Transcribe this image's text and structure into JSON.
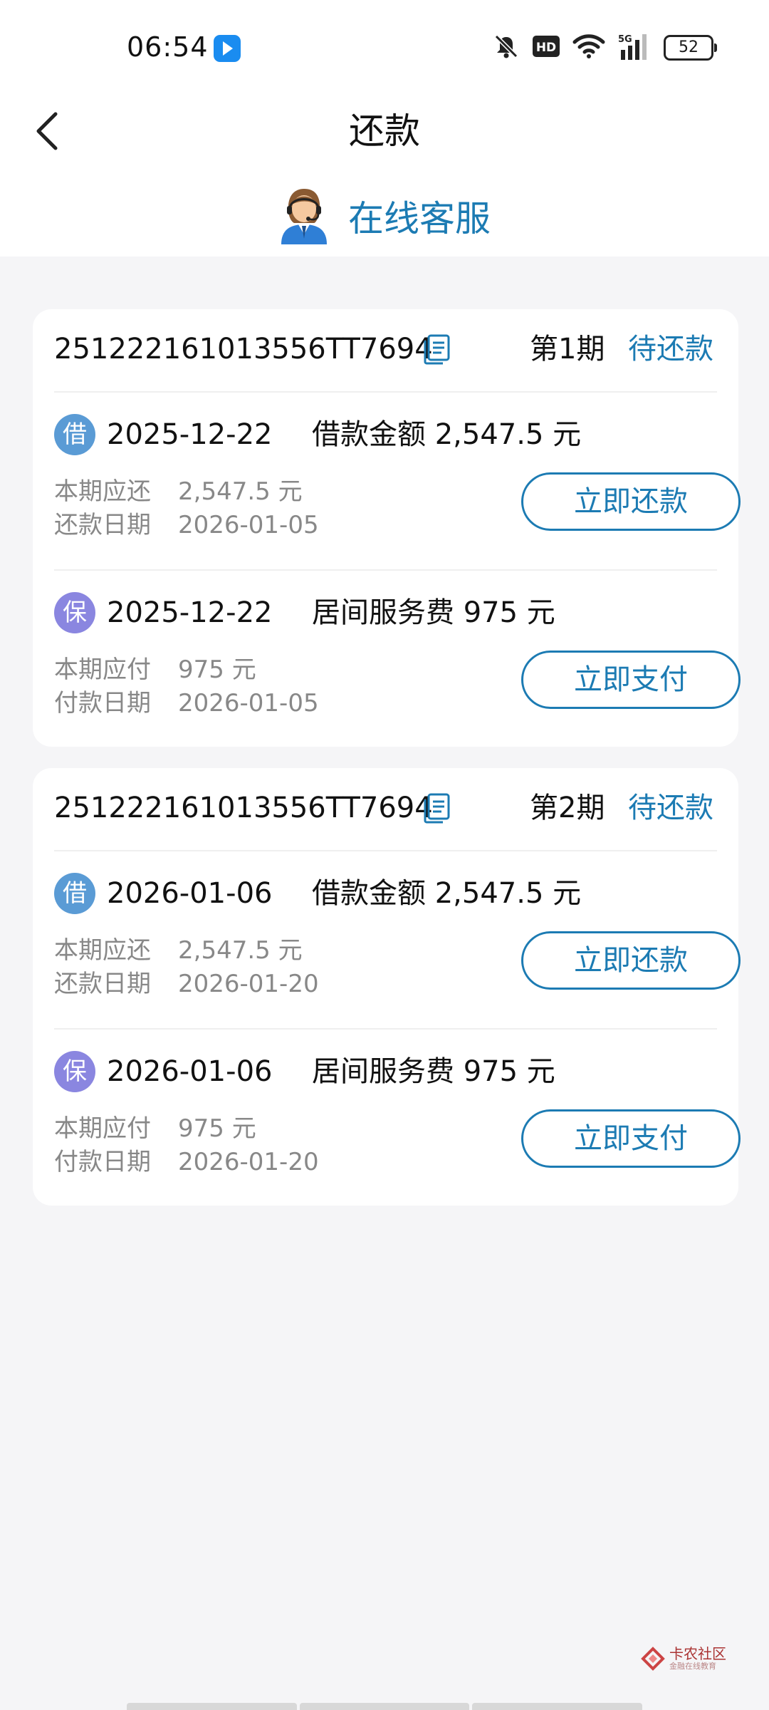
{
  "status_bar": {
    "time": "06:54",
    "battery": "52"
  },
  "header": {
    "title": "还款",
    "customer_service": "在线客服"
  },
  "cards": [
    {
      "order_no": "251222161013556TT7694",
      "period": "第1期",
      "status": "待还款",
      "loan": {
        "badge": "借",
        "date": "2025-12-22",
        "desc": "借款金额 2,547.5 元",
        "due_label": "本期应还",
        "due_value": "2,547.5 元",
        "date_label": "还款日期",
        "date_value": "2026-01-05",
        "button": "立即还款"
      },
      "fee": {
        "badge": "保",
        "date": "2025-12-22",
        "desc": "居间服务费 975 元",
        "due_label": "本期应付",
        "due_value": "975 元",
        "date_label": "付款日期",
        "date_value": "2026-01-05",
        "button": "立即支付"
      }
    },
    {
      "order_no": "251222161013556TT7694",
      "period": "第2期",
      "status": "待还款",
      "loan": {
        "badge": "借",
        "date": "2026-01-06",
        "desc": "借款金额 2,547.5 元",
        "due_label": "本期应还",
        "due_value": "2,547.5 元",
        "date_label": "还款日期",
        "date_value": "2026-01-20",
        "button": "立即还款"
      },
      "fee": {
        "badge": "保",
        "date": "2026-01-06",
        "desc": "居间服务费 975 元",
        "due_label": "本期应付",
        "due_value": "975 元",
        "date_label": "付款日期",
        "date_value": "2026-01-20",
        "button": "立即支付"
      }
    }
  ],
  "watermark": {
    "title": "卡农社区",
    "subtitle": "金融在线教育"
  },
  "colors": {
    "accent": "#1c7bb3",
    "background": "#f5f5f7",
    "badge_loan": "#5a9bd5",
    "badge_fee": "#8a86e0"
  },
  "icons": [
    "back-arrow-icon",
    "customer-service-agent-icon",
    "copy-icon",
    "mute-bell-icon",
    "hd-icon",
    "wifi-icon",
    "5g-signal-icon",
    "battery-icon",
    "app-notification-icon"
  ]
}
